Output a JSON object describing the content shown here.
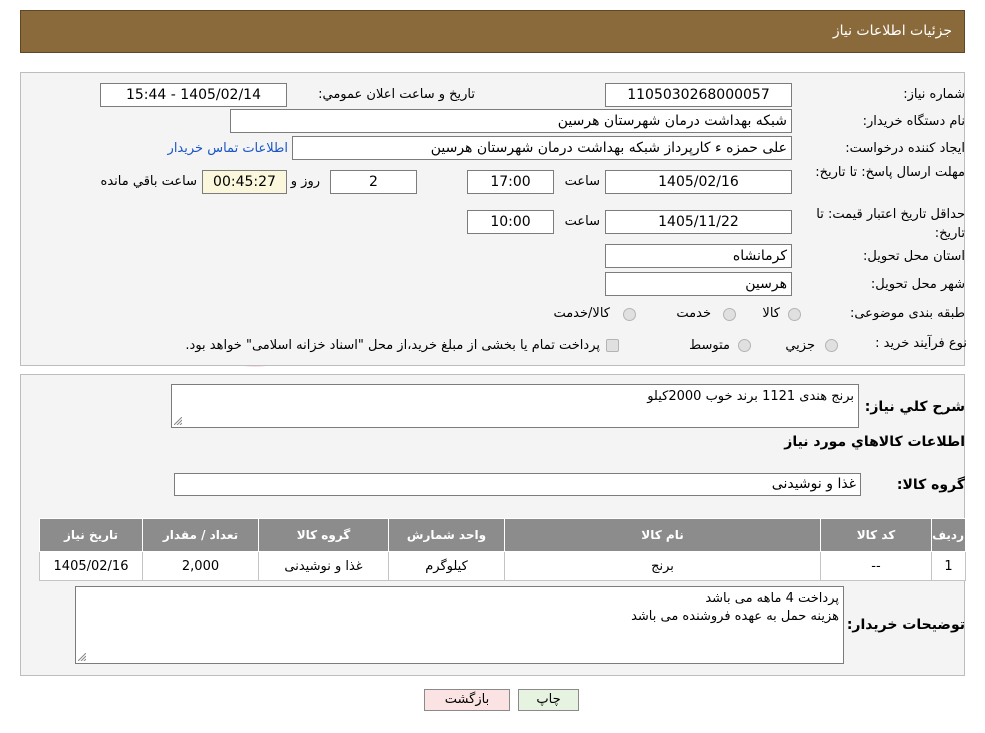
{
  "header": {
    "title": "جزئیات اطلاعات نیاز"
  },
  "need": {
    "number_label": "شماره نیاز:",
    "number": "1105030268000057",
    "announce_label": "تاريخ و ساعت اعلان عمومي:",
    "announce_value": "1405/02/14 - 15:44",
    "buyer_label": "نام دستگاه خريدار:",
    "buyer": "شبکه بهداشت درمان شهرستان هرسین",
    "creator_label": "ايجاد کننده درخواست:",
    "creator": "علی حمزه ء کارپرداز شبکه بهداشت درمان شهرستان هرسین",
    "contact_link": "اطلاعات تماس خريدار",
    "deadline_label": "مهلت ارسال پاسخ: تا تاریخ:",
    "deadline_date": "1405/02/16",
    "time_label": "ساعت",
    "deadline_time": "17:00",
    "days": "2",
    "days_label": "روز و",
    "remaining": "00:45:27",
    "remaining_label": "ساعت باقي مانده",
    "validity_label": "حداقل تاريخ اعتبار قيمت: تا تاریخ:",
    "validity_date": "1405/11/22",
    "validity_time": "10:00",
    "province_label": "استان محل تحويل:",
    "province": "کرمانشاه",
    "city_label": "شهر محل تحويل:",
    "city": "هرسین",
    "category_label": "طبقه بندی موضوعی:",
    "category_options": [
      "كالا",
      "خدمت",
      "كالا/خدمت"
    ],
    "process_label": "نوع فرآيند خريد :",
    "process_options": [
      "جزيي",
      "متوسط"
    ],
    "process_note": "پرداخت تمام يا بخشی از مبلغ خريد،از محل \"اسناد خزانه اسلامی\" خواهد بود."
  },
  "summary": {
    "desc_label": "شرح کلي نياز:",
    "desc": "برنج هندی 1121 برند خوب 2000کیلو",
    "goods_heading": "اطلاعات کالاهاي مورد نياز",
    "group_label": "گروه کالا:",
    "group": "غذا و نوشیدنی"
  },
  "table": {
    "headers": [
      "رديف",
      "کد کالا",
      "نام کالا",
      "واحد شمارش",
      "گروه کالا",
      "تعداد / مقدار",
      "تاريخ نياز"
    ],
    "rows": [
      [
        "1",
        "--",
        "برنج",
        "کیلوگرم",
        "غذا و نوشیدنی",
        "2,000",
        "1405/02/16"
      ]
    ]
  },
  "notes": {
    "label": "توضيحات خريدار:",
    "line1": "پرداخت 4 ماهه می باشد",
    "line2": "هزینه حمل به عهده فروشنده می باشد"
  },
  "buttons": {
    "print": "چاپ",
    "back": "بازگشت"
  },
  "colors": {
    "header": "#8a6a3a",
    "table_header": "#8c8c8c",
    "print_btn": "#e6f3e0",
    "back_btn": "#fbe3e3"
  }
}
